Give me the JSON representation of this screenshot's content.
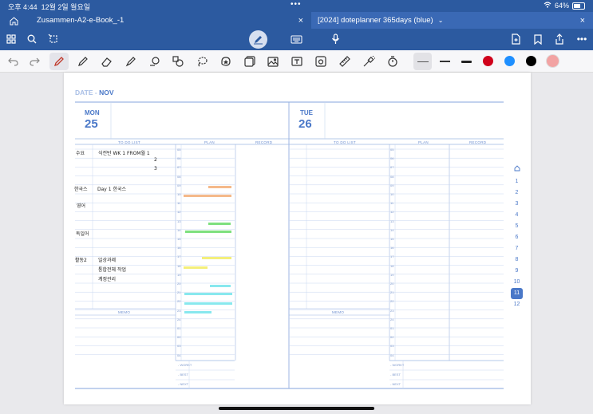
{
  "status": {
    "time": "오후 4:44",
    "date": "12월 2일 월요일",
    "dots": "•••",
    "battery": "64%"
  },
  "tabs": [
    {
      "label": "Zusammen-A2-e-Book_-1"
    },
    {
      "label": "[2024] doteplanner 365days (blue)"
    }
  ],
  "page": {
    "date_label": "DATE -",
    "month": "NOV",
    "days": [
      {
        "dow": "MON",
        "num": "25"
      },
      {
        "dow": "TUE",
        "num": "26"
      }
    ],
    "col_todo": "TO DO LIST",
    "col_plan": "PLAN",
    "col_record": "RECORD",
    "memo": "MEMO",
    "hours": [
      "05",
      "06",
      "07",
      "08",
      "09",
      "10",
      "11",
      "12",
      "13",
      "14",
      "15",
      "16",
      "17",
      "18",
      "19",
      "20",
      "21",
      "22",
      "23",
      "24",
      "01",
      "02",
      "03",
      "04"
    ],
    "footer_labels": [
      "- WORKT",
      "- BEST",
      "- NEXT"
    ],
    "handwriting": [
      {
        "key": "수요",
        "text": "식전반 WK 1 FROM월 1"
      },
      {
        "key": "",
        "text": "2"
      },
      {
        "key": "",
        "text": "3"
      },
      {
        "key": "한국스",
        "text": "Day 1 한국스"
      },
      {
        "key": "영어",
        "text": ""
      },
      {
        "key": "독일어",
        "text": ""
      },
      {
        "key": "활동2",
        "text": "일상과제"
      },
      {
        "key": "",
        "text": "통합전체 작업"
      },
      {
        "key": "",
        "text": "계정관리"
      }
    ]
  },
  "colors": {
    "orange": "#f5b98a",
    "green": "#7ee07e",
    "yellow": "#f4ef7a",
    "cyan": "#88e8ee",
    "accent": "#4a78c8",
    "red": "#d0021b",
    "blue": "#1e8fff",
    "black": "#000000",
    "pink": "#f2a3a3"
  },
  "side_nav": [
    "1",
    "2",
    "3",
    "4",
    "5",
    "6",
    "7",
    "8",
    "9",
    "10",
    "11",
    "12"
  ],
  "side_nav_active": "11"
}
